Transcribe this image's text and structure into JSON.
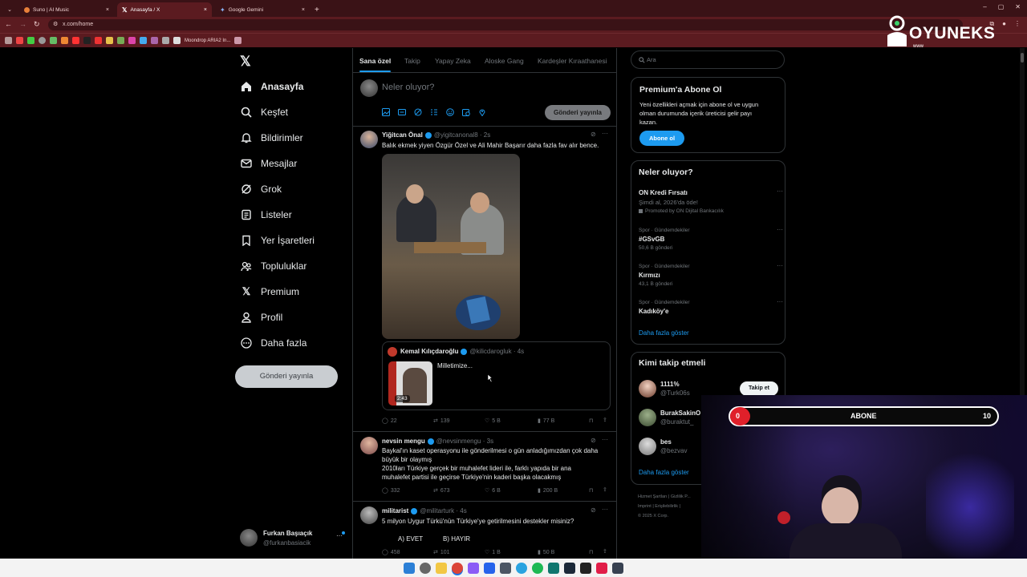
{
  "browser": {
    "tabs": [
      {
        "title": "Suno | AI Music",
        "close": "×",
        "color": "#e8803a"
      },
      {
        "title": "Anasayfa / X",
        "close": "×",
        "color": "#ffffff"
      },
      {
        "title": "Google Gemini",
        "close": "×",
        "color": "#8ab4f8"
      }
    ],
    "new_tab": "+",
    "url": "x.com/home",
    "bookmark_label": "Moondrop ARIA2 In..."
  },
  "watermark": {
    "brand": "OYUNEKS",
    "sub": "www"
  },
  "nav": {
    "items": [
      {
        "label": "Anasayfa",
        "icon": "home-icon"
      },
      {
        "label": "Keşfet",
        "icon": "search-icon"
      },
      {
        "label": "Bildirimler",
        "icon": "bell-icon"
      },
      {
        "label": "Mesajlar",
        "icon": "mail-icon"
      },
      {
        "label": "Grok",
        "icon": "grok-icon"
      },
      {
        "label": "Listeler",
        "icon": "list-icon"
      },
      {
        "label": "Yer İşaretleri",
        "icon": "bookmark-icon"
      },
      {
        "label": "Topluluklar",
        "icon": "communities-icon"
      },
      {
        "label": "Premium",
        "icon": "x-logo-icon"
      },
      {
        "label": "Profil",
        "icon": "person-icon"
      },
      {
        "label": "Daha fazla",
        "icon": "more-icon"
      }
    ],
    "post_button": "Gönderi yayınla",
    "account_name": "Furkan Başıaçık",
    "account_handle": "@furkanbasiacik"
  },
  "feed": {
    "tabs": [
      "Sana özel",
      "Takip",
      "Yapay Zeka",
      "Aloske Gang",
      "Kardeşler Kıraathanesi"
    ],
    "compose_placeholder": "Neler oluyor?",
    "compose_button": "Gönderi yayınla",
    "posts": [
      {
        "name": "Yiğitcan Önal",
        "handle": "@yigitcanonal8 · 2s",
        "text": "Balık ekmek yiyen Özgür Özel ve Ali Mahir Başarır daha fazla fav alır bence.",
        "quote": {
          "name": "Kemal Kılıçdaroğlu",
          "handle": "@kilicdarogluk · 4s",
          "text": "Milletimize...",
          "video_duration": "2:43"
        },
        "stats": {
          "replies": "22",
          "reposts": "139",
          "likes": "5 B",
          "views": "77 B"
        }
      },
      {
        "name": "nevsin mengu",
        "handle": "@nevsinmengu · 3s",
        "lines": [
          "Baykal'ın kaset operasyonu ile gönderilmesi o gün anladığımızdan çok daha",
          "büyük bir olaymış",
          "2010ları Türkiye gerçek bir muhalefet lideri ile, farklı yapıda bir ana",
          "muhalefet partisi ile geçirse Türkiye'nin kaderi başka olacakmış"
        ],
        "stats": {
          "replies": "332",
          "reposts": "673",
          "likes": "6 B",
          "views": "200 B"
        }
      },
      {
        "name": "militarist",
        "handle": "@militarturk · 4s",
        "text": "5 milyon Uygur Türkü'nün Türkiye'ye getirilmesini destekler misiniz?",
        "options": [
          "A) EVET",
          "B) HAYIR"
        ],
        "stats": {
          "replies": "458",
          "reposts": "101",
          "likes": "1 B",
          "views": "50 B"
        }
      }
    ]
  },
  "sidebar": {
    "search_placeholder": "Ara",
    "premium": {
      "title": "Premium'a Abone Ol",
      "lines": [
        "Yeni özellikleri açmak için abone ol ve uygun",
        "olman durumunda içerik üreticisi gelir payı",
        "kazan."
      ],
      "button": "Abone ol"
    },
    "trends": {
      "title": "Neler oluyor?",
      "promo": {
        "name": "ON Kredi Fırsatı",
        "sub": "Şimdi al, 2026'da öde!",
        "promoted": "Promoted by ON Dijital Bankacılık"
      },
      "items": [
        {
          "context": "Spor · Gündemdekiler",
          "name": "#GSvGB",
          "count": "50,6 B gönderi"
        },
        {
          "context": "Spor · Gündemdekiler",
          "name": "Kırmızı",
          "count": "43,1 B gönderi"
        },
        {
          "context": "Spor · Gündemdekiler",
          "name": "Kadıköy'e",
          "count": ""
        }
      ],
      "more": "Daha fazla göster"
    },
    "who_to_follow": {
      "title": "Kimi takip etmeli",
      "users": [
        {
          "name": "1111%",
          "handle": "@Turk06s"
        },
        {
          "name": "BurakSakinO",
          "handle": "@buraktut_"
        },
        {
          "name": "bes",
          "handle": "@bezvav"
        }
      ],
      "follow_button": "Takip et",
      "more": "Daha fazla göster"
    },
    "footer_line1": "Hizmet Şartları  |  Gizlilik P...",
    "footer_line2": "Imprint  |  Erişilebilirlik  |",
    "footer_line3": "© 2025 X Corp."
  },
  "overlay": {
    "label": "ABONE",
    "current": "0",
    "goal": "10",
    "progress": 0.0
  }
}
